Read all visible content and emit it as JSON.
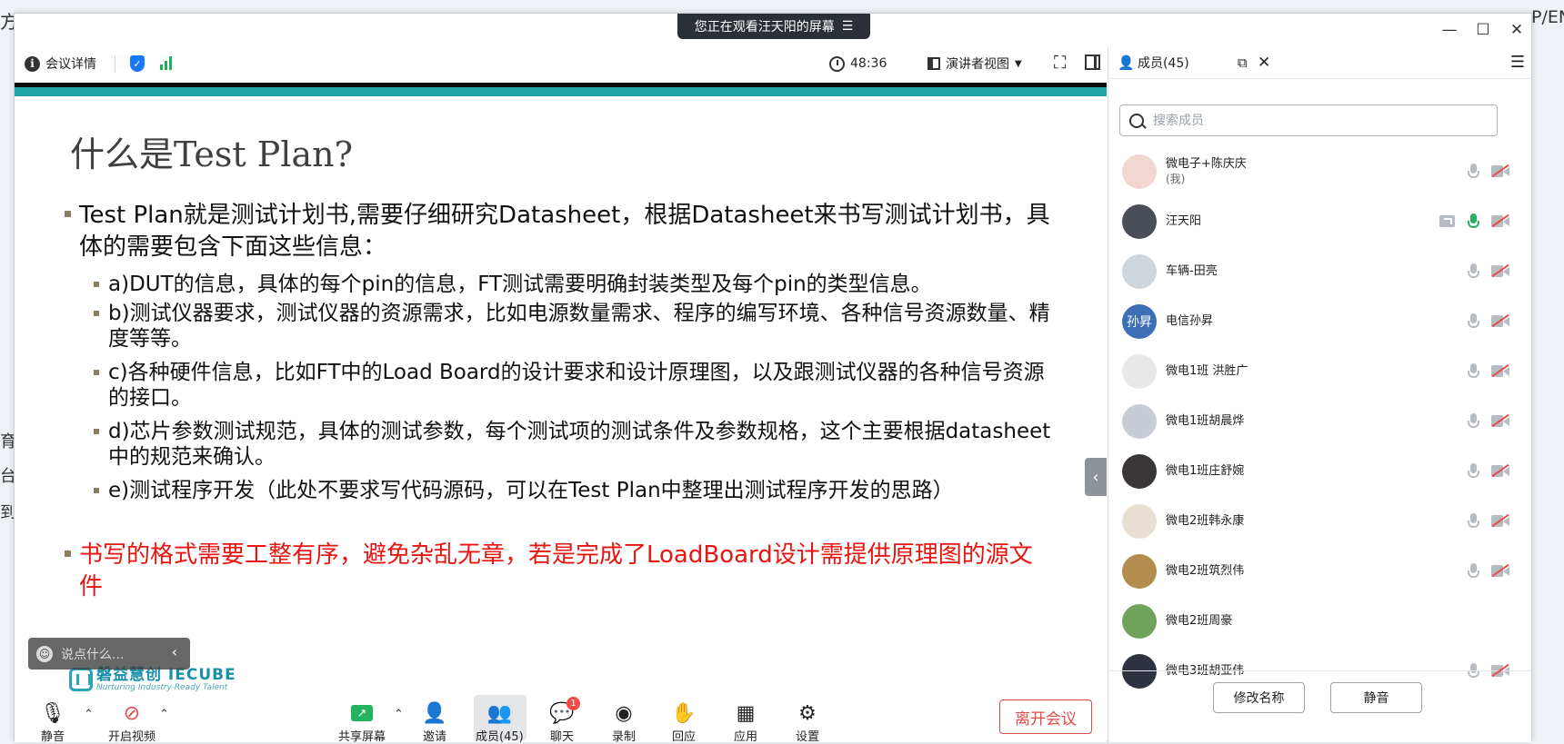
{
  "desktop": {
    "left_edge": "方",
    "right_edge": "P/EN",
    "left_side_chars": [
      "育",
      "台",
      "到"
    ]
  },
  "banner": {
    "text": "您正在观看汪天阳的屏幕",
    "menu_icon": "menu-lines-icon"
  },
  "toolbar": {
    "meeting_info_label": "会议详情",
    "timer": "48:36",
    "view_label": "演讲者视图"
  },
  "slide": {
    "title": "什么是Test Plan?",
    "bullet_main": "Test Plan就是测试计划书,需要仔细研究Datasheet，根据Datasheet来书写测试计划书，具体的需要包含下面这些信息：",
    "sub_items": [
      "a)DUT的信息，具体的每个pin的信息，FT测试需要明确封装类型及每个pin的类型信息。",
      "b)测试仪器要求，测试仪器的资源需求，比如电源数量需求、程序的编写环境、各种信号资源数量、精度等等。",
      "c)各种硬件信息，比如FT中的Load Board的设计要求和设计原理图，以及跟测试仪器的各种信号资源的接口。",
      "d)芯片参数测试规范，具体的测试参数，每个测试项的测试条件及参数规格，这个主要根据datasheet中的规范来确认。",
      "e)测试程序开发（此处不要求写代码源码，可以在Test Plan中整理出测试程序开发的思路）"
    ],
    "bullet_red": "书写的格式需要工整有序，避免杂乱无章，若是完成了LoadBoard设计需提供原理图的源文件",
    "logo_main": "磐益慧创 IECUBE",
    "logo_sub": "Nurturing Industry-Ready Talent",
    "accent_color": "#20a4a3",
    "red_color": "#e8140f"
  },
  "chat_float": {
    "placeholder": "说点什么..."
  },
  "controls": {
    "mute": "静音",
    "video": "开启视频",
    "share": "共享屏幕",
    "invite": "邀请",
    "members": "成员(45)",
    "chat": "聊天",
    "chat_badge": "1",
    "record": "录制",
    "react": "回应",
    "apps": "应用",
    "settings": "设置",
    "leave": "离开会议"
  },
  "members_panel": {
    "title": "成员(45)",
    "search_placeholder": "搜索成员",
    "members": [
      {
        "name": "微电子+陈庆庆",
        "sub": "(我)",
        "mic": "muted_gray",
        "avatar_color": "#f2d6d0",
        "avatar_text": ""
      },
      {
        "name": "汪天阳",
        "sub": "",
        "mic": "on",
        "sharing": true,
        "avatar_color": "#4a4f57",
        "avatar_text": ""
      },
      {
        "name": "车辆-田亮",
        "sub": "",
        "mic": "muted",
        "avatar_color": "#cfd6dc",
        "avatar_text": ""
      },
      {
        "name": "电信孙昇",
        "sub": "",
        "mic": "muted",
        "avatar_color": "#3d6fb6",
        "avatar_text": "孙昇"
      },
      {
        "name": "微电1班  洪胜广",
        "sub": "",
        "mic": "muted",
        "avatar_color": "#e8e8e8",
        "avatar_text": ""
      },
      {
        "name": "微电1班胡晨烨",
        "sub": "",
        "mic": "muted",
        "avatar_color": "#c7ccd6",
        "avatar_text": ""
      },
      {
        "name": "微电1班庄舒婉",
        "sub": "",
        "mic": "muted",
        "avatar_color": "#3a3536",
        "avatar_text": ""
      },
      {
        "name": "微电2班韩永康",
        "sub": "",
        "mic": "muted",
        "avatar_color": "#e9ded2",
        "avatar_text": ""
      },
      {
        "name": "微电2班筑烈伟",
        "sub": "",
        "mic": "muted",
        "avatar_color": "#b38d4e",
        "avatar_text": ""
      },
      {
        "name": "微电2班周豪",
        "sub": "",
        "mic": "none",
        "avatar_color": "#6fa35b",
        "avatar_text": ""
      },
      {
        "name": "微电3班胡亚伟",
        "sub": "",
        "mic": "muted",
        "avatar_color": "#2d3140",
        "avatar_text": ""
      }
    ],
    "rename_button": "修改名称",
    "mute_button": "静音"
  }
}
